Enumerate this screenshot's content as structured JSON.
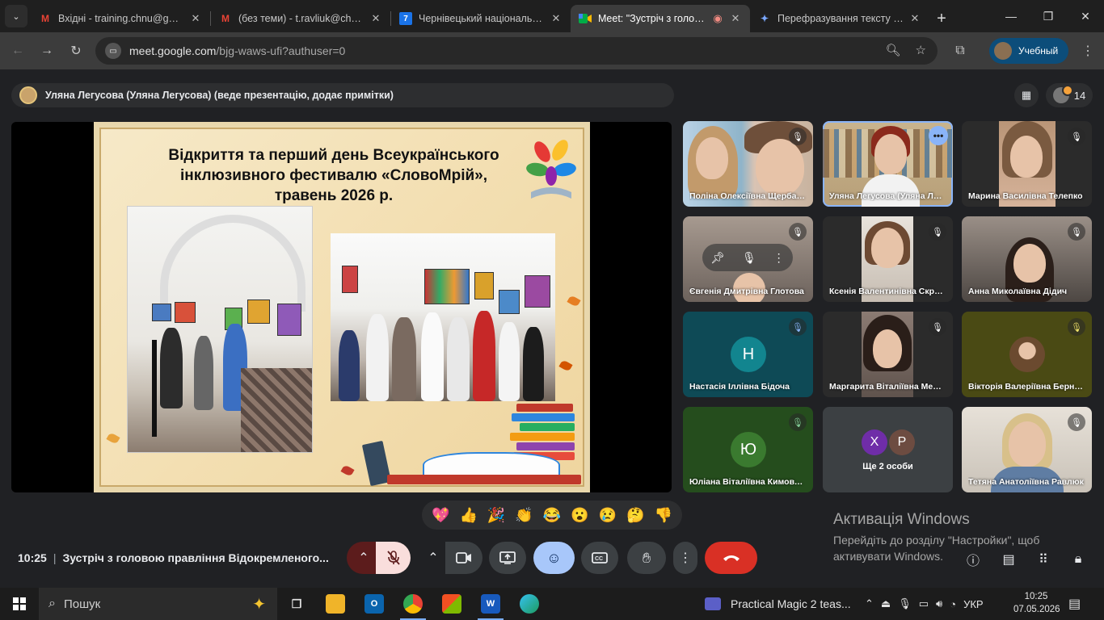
{
  "browser": {
    "tabs": [
      {
        "title": "Вхідні - training.chnu@gmail.com",
        "icon": "gmail-icon",
        "active": false
      },
      {
        "title": "(без теми) - t.ravliuk@chnu.edu.ua",
        "icon": "gmail-icon",
        "active": false
      },
      {
        "title": "Чернівецький національний університет",
        "icon": "site-7-icon",
        "active": false
      },
      {
        "title": "Meet: \"Зустріч з головою правління\"",
        "icon": "meet-icon",
        "active": true
      },
      {
        "title": "Перефразування тексту про",
        "icon": "gemini-icon",
        "active": false
      }
    ],
    "url_host": "meet.google.com",
    "url_path": "/bjg-waws-ufi?authuser=0",
    "profile_label": "Учебный"
  },
  "meet": {
    "presenter_text": "Уляна Легусова (Уляна Легусова) (веде презентацію, додає примітки)",
    "participant_count": "14",
    "slide_title": "Відкриття та перший день Всеукраїнського інклюзивного фестивалю «СловоМрій», травень 2026 р.",
    "tiles": [
      {
        "name": "Поліна Олексіївна Щербанюк"
      },
      {
        "name": "Уляна Легусова (Уляна Легусова)"
      },
      {
        "name": "Марина Василівна Телепко"
      },
      {
        "name": "Євгенія Дмитрівна Глотова"
      },
      {
        "name": "Ксенія Валентинівна Скрипник"
      },
      {
        "name": "Анна Миколаївна Дідич"
      },
      {
        "name": "Настасія Іллівна Бідоча",
        "initial": "Н"
      },
      {
        "name": "Маргарита Віталіївна Мельник"
      },
      {
        "name": "Вікторія Валеріївна Бернацька"
      },
      {
        "name": "Юліана Віталіївна Кимовська",
        "initial": "Ю"
      },
      {
        "name": "Ще 2 особи",
        "initials": [
          "Х",
          "Р"
        ]
      },
      {
        "name": "Тетяна Анатоліївна Равлюк"
      }
    ],
    "reactions": [
      "💖",
      "👍",
      "🎉",
      "👏",
      "😂",
      "😮",
      "😢",
      "🤔",
      "👎"
    ],
    "time": "10:25",
    "meeting_title": "Зустріч з головою правління Відокремленого...",
    "colors": {
      "accent": "#8ab4f8",
      "hangup": "#d93025",
      "mic_off": "#f9dedc"
    }
  },
  "activation": {
    "title": "Активація Windows",
    "text": "Перейдіть до розділу \"Настройки\", щоб активувати Windows."
  },
  "taskbar": {
    "search_label": "Пошук",
    "media_title": "Practical Magic 2 teas...",
    "language": "УКР",
    "clock_time": "10:25",
    "clock_date": "07.05.2026"
  }
}
